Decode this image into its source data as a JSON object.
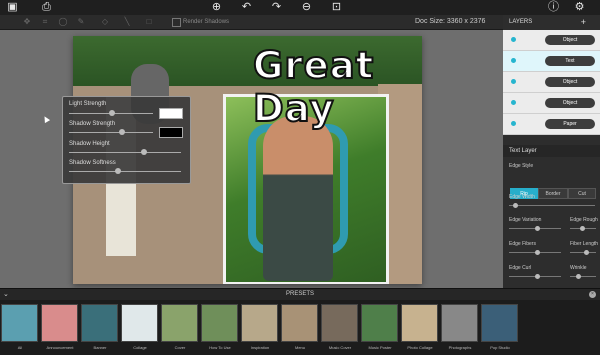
{
  "toolbar": {
    "icons": [
      "image-icon",
      "print-icon",
      "zoom-in-icon",
      "undo-icon",
      "redo-icon",
      "zoom-out-icon",
      "fit-icon",
      "info-icon",
      "settings-icon"
    ],
    "render_shadows_label": "Render Shadows",
    "doc_size": "Doc Size: 3360 x 2376"
  },
  "canvas": {
    "title_text": "Great Day"
  },
  "shadow_popup": {
    "light_strength": "Light Strength",
    "shadow_strength": "Shadow Strength",
    "shadow_height": "Shadow Height",
    "shadow_softness": "Shadow Softness",
    "light_strength_value": 0.5,
    "shadow_strength_value": 0.6,
    "shadow_height_value": 0.85,
    "shadow_softness_value": 0.6,
    "light_color": "#ffffff",
    "shadow_color": "#000000"
  },
  "layers": {
    "header": "LAYERS",
    "add": "+",
    "items": [
      {
        "label": "Object",
        "selected": false
      },
      {
        "label": "Text",
        "selected": true
      },
      {
        "label": "Object",
        "selected": false
      },
      {
        "label": "Object",
        "selected": false
      },
      {
        "label": "Paper",
        "selected": false
      }
    ]
  },
  "text_layer": {
    "header": "Text Layer",
    "edge_style": "Edge Style",
    "styles": [
      "Rip",
      "Border",
      "Cut"
    ],
    "active_style": "Rip",
    "edge_width": "Edge Width",
    "edge_variation": "Edge Variation",
    "edge_roughness": "Edge Rough",
    "edge_fibers": "Edge Fibers",
    "fiber_length": "Fiber Length",
    "edge_curl": "Edge Curl",
    "wrinkle": "Wrinkle"
  },
  "presets": {
    "title": "PRESETS",
    "items": [
      "All",
      "Announcement",
      "Banner",
      "Collage",
      "Cover",
      "How To Use",
      "Inspiration",
      "Menu",
      "Music Cover",
      "Music Poster",
      "Photo Collage",
      "Photographs",
      "Pop Studio"
    ]
  },
  "colors": {
    "accent": "#27aecb",
    "panel": "#2d2d2d",
    "green_banner": "#3c6a2f"
  }
}
